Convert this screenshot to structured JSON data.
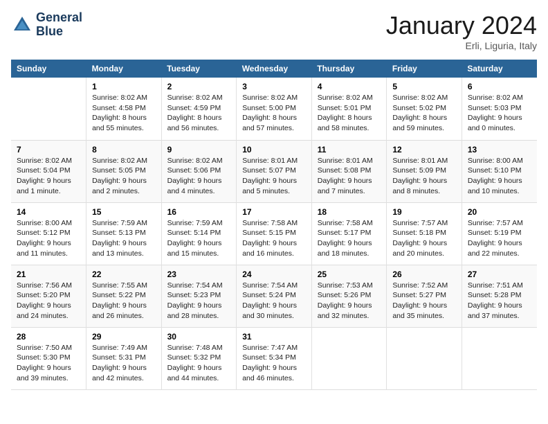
{
  "logo": {
    "line1": "General",
    "line2": "Blue"
  },
  "title": "January 2024",
  "location": "Erli, Liguria, Italy",
  "days_of_week": [
    "Sunday",
    "Monday",
    "Tuesday",
    "Wednesday",
    "Thursday",
    "Friday",
    "Saturday"
  ],
  "weeks": [
    [
      {
        "day": "",
        "content": ""
      },
      {
        "day": "1",
        "content": "Sunrise: 8:02 AM\nSunset: 4:58 PM\nDaylight: 8 hours\nand 55 minutes."
      },
      {
        "day": "2",
        "content": "Sunrise: 8:02 AM\nSunset: 4:59 PM\nDaylight: 8 hours\nand 56 minutes."
      },
      {
        "day": "3",
        "content": "Sunrise: 8:02 AM\nSunset: 5:00 PM\nDaylight: 8 hours\nand 57 minutes."
      },
      {
        "day": "4",
        "content": "Sunrise: 8:02 AM\nSunset: 5:01 PM\nDaylight: 8 hours\nand 58 minutes."
      },
      {
        "day": "5",
        "content": "Sunrise: 8:02 AM\nSunset: 5:02 PM\nDaylight: 8 hours\nand 59 minutes."
      },
      {
        "day": "6",
        "content": "Sunrise: 8:02 AM\nSunset: 5:03 PM\nDaylight: 9 hours\nand 0 minutes."
      }
    ],
    [
      {
        "day": "7",
        "content": "Sunrise: 8:02 AM\nSunset: 5:04 PM\nDaylight: 9 hours\nand 1 minute."
      },
      {
        "day": "8",
        "content": "Sunrise: 8:02 AM\nSunset: 5:05 PM\nDaylight: 9 hours\nand 2 minutes."
      },
      {
        "day": "9",
        "content": "Sunrise: 8:02 AM\nSunset: 5:06 PM\nDaylight: 9 hours\nand 4 minutes."
      },
      {
        "day": "10",
        "content": "Sunrise: 8:01 AM\nSunset: 5:07 PM\nDaylight: 9 hours\nand 5 minutes."
      },
      {
        "day": "11",
        "content": "Sunrise: 8:01 AM\nSunset: 5:08 PM\nDaylight: 9 hours\nand 7 minutes."
      },
      {
        "day": "12",
        "content": "Sunrise: 8:01 AM\nSunset: 5:09 PM\nDaylight: 9 hours\nand 8 minutes."
      },
      {
        "day": "13",
        "content": "Sunrise: 8:00 AM\nSunset: 5:10 PM\nDaylight: 9 hours\nand 10 minutes."
      }
    ],
    [
      {
        "day": "14",
        "content": "Sunrise: 8:00 AM\nSunset: 5:12 PM\nDaylight: 9 hours\nand 11 minutes."
      },
      {
        "day": "15",
        "content": "Sunrise: 7:59 AM\nSunset: 5:13 PM\nDaylight: 9 hours\nand 13 minutes."
      },
      {
        "day": "16",
        "content": "Sunrise: 7:59 AM\nSunset: 5:14 PM\nDaylight: 9 hours\nand 15 minutes."
      },
      {
        "day": "17",
        "content": "Sunrise: 7:58 AM\nSunset: 5:15 PM\nDaylight: 9 hours\nand 16 minutes."
      },
      {
        "day": "18",
        "content": "Sunrise: 7:58 AM\nSunset: 5:17 PM\nDaylight: 9 hours\nand 18 minutes."
      },
      {
        "day": "19",
        "content": "Sunrise: 7:57 AM\nSunset: 5:18 PM\nDaylight: 9 hours\nand 20 minutes."
      },
      {
        "day": "20",
        "content": "Sunrise: 7:57 AM\nSunset: 5:19 PM\nDaylight: 9 hours\nand 22 minutes."
      }
    ],
    [
      {
        "day": "21",
        "content": "Sunrise: 7:56 AM\nSunset: 5:20 PM\nDaylight: 9 hours\nand 24 minutes."
      },
      {
        "day": "22",
        "content": "Sunrise: 7:55 AM\nSunset: 5:22 PM\nDaylight: 9 hours\nand 26 minutes."
      },
      {
        "day": "23",
        "content": "Sunrise: 7:54 AM\nSunset: 5:23 PM\nDaylight: 9 hours\nand 28 minutes."
      },
      {
        "day": "24",
        "content": "Sunrise: 7:54 AM\nSunset: 5:24 PM\nDaylight: 9 hours\nand 30 minutes."
      },
      {
        "day": "25",
        "content": "Sunrise: 7:53 AM\nSunset: 5:26 PM\nDaylight: 9 hours\nand 32 minutes."
      },
      {
        "day": "26",
        "content": "Sunrise: 7:52 AM\nSunset: 5:27 PM\nDaylight: 9 hours\nand 35 minutes."
      },
      {
        "day": "27",
        "content": "Sunrise: 7:51 AM\nSunset: 5:28 PM\nDaylight: 9 hours\nand 37 minutes."
      }
    ],
    [
      {
        "day": "28",
        "content": "Sunrise: 7:50 AM\nSunset: 5:30 PM\nDaylight: 9 hours\nand 39 minutes."
      },
      {
        "day": "29",
        "content": "Sunrise: 7:49 AM\nSunset: 5:31 PM\nDaylight: 9 hours\nand 42 minutes."
      },
      {
        "day": "30",
        "content": "Sunrise: 7:48 AM\nSunset: 5:32 PM\nDaylight: 9 hours\nand 44 minutes."
      },
      {
        "day": "31",
        "content": "Sunrise: 7:47 AM\nSunset: 5:34 PM\nDaylight: 9 hours\nand 46 minutes."
      },
      {
        "day": "",
        "content": ""
      },
      {
        "day": "",
        "content": ""
      },
      {
        "day": "",
        "content": ""
      }
    ]
  ]
}
